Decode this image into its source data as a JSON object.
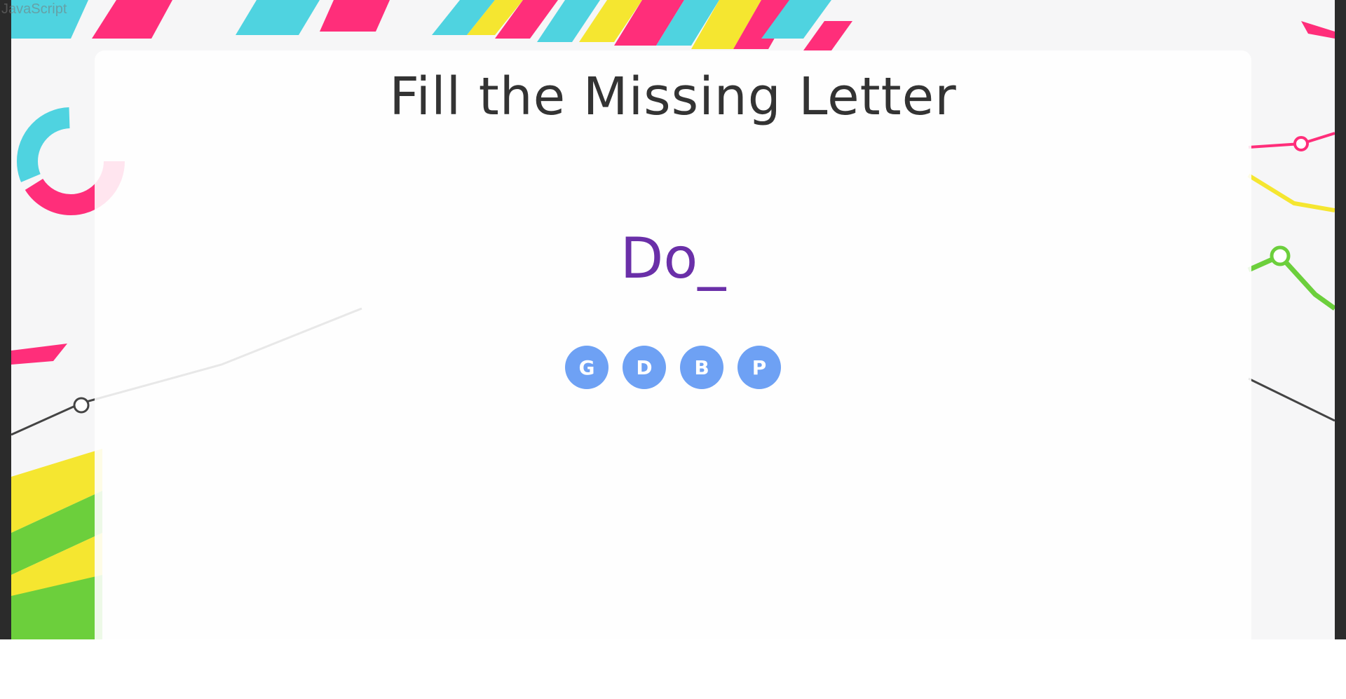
{
  "top_label": "JavaScript",
  "game": {
    "title": "Fill the Missing Letter",
    "word": "Do_",
    "options": [
      "G",
      "D",
      "B",
      "P"
    ]
  },
  "colors": {
    "title": "#333333",
    "word": "#6a2fa8",
    "option_bg": "#6ea1f4",
    "option_text": "#ffffff"
  }
}
